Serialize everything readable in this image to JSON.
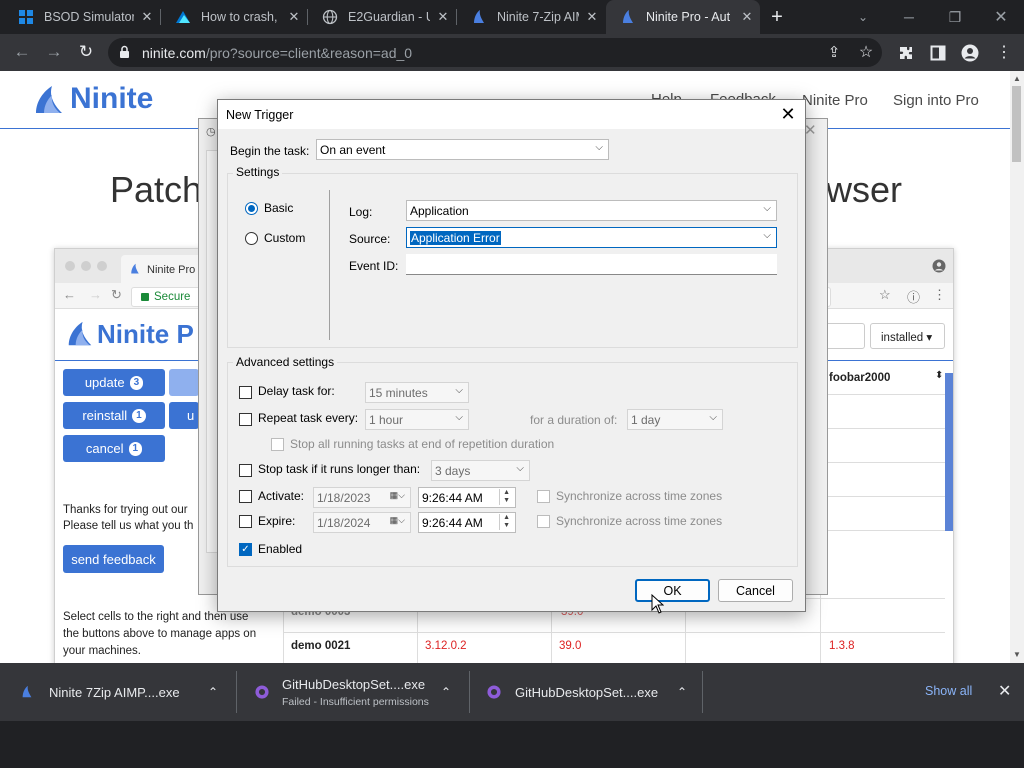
{
  "browser": {
    "tabs": [
      {
        "title": "BSOD Simulator",
        "fav": "windows-icon"
      },
      {
        "title": "How to crash, h",
        "fav": "azure-icon"
      },
      {
        "title": "E2Guardian - Ur",
        "fav": "globe-icon"
      },
      {
        "title": "Ninite 7-Zip AIM",
        "fav": "ninite-icon"
      },
      {
        "title": "Ninite Pro - Aut",
        "fav": "ninite-icon",
        "active": true
      }
    ],
    "url_host": "ninite.com",
    "url_path": "/pro?source=client&reason=ad_0"
  },
  "site": {
    "logo": "Ninite",
    "nav": [
      "Help",
      "Feedback",
      "Ninite Pro",
      "Sign into Pro"
    ],
    "hero_left": "Patch",
    "hero_right": "wser",
    "accent": "#3b73d3",
    "inner_window": {
      "tab_title": "Ninite Pro",
      "secure": "Secure",
      "logo": "Ninite P",
      "buttons": [
        {
          "label": "update",
          "count": "3"
        },
        {
          "label": "reinstall",
          "count": "1"
        },
        {
          "label": "cancel",
          "count": "1"
        }
      ],
      "thanks_line1": "Thanks for trying out our",
      "thanks_line2": "Please tell us what you th",
      "send_feedback": "send feedback",
      "select_text": [
        "Select cells to the right and then use",
        "the buttons above to manage apps on",
        "your machines."
      ],
      "filter_select": "installed",
      "col_header": "foobar2000",
      "rows": [
        {
          "machine": "demo 0003",
          "v1": "",
          "v2": "39.0",
          "v3": ""
        },
        {
          "machine": "demo 0021",
          "v1": "3.12.0.2",
          "v2": "39.0",
          "v3": "1.3.8"
        }
      ]
    }
  },
  "dialog": {
    "title": "New Trigger",
    "begin_label": "Begin the task:",
    "begin_value": "On an event",
    "settings_label": "Settings",
    "radio_basic": "Basic",
    "radio_custom": "Custom",
    "log_label": "Log:",
    "log_value": "Application",
    "source_label": "Source:",
    "source_value": "Application Error",
    "eventid_label": "Event ID:",
    "eventid_value": "",
    "advanced_label": "Advanced settings",
    "delay_label": "Delay task for:",
    "delay_value": "15 minutes",
    "repeat_label": "Repeat task every:",
    "repeat_value": "1 hour",
    "duration_label": "for a duration of:",
    "duration_value": "1 day",
    "stop_all_label": "Stop all running tasks at end of repetition duration",
    "stop_longer_label": "Stop task if it runs longer than:",
    "stop_longer_value": "3 days",
    "activate_label": "Activate:",
    "activate_date": "1/18/2023",
    "activate_time": "9:26:44 AM",
    "expire_label": "Expire:",
    "expire_date": "1/18/2024",
    "expire_time": "9:26:44 AM",
    "sync_label": "Synchronize across time zones",
    "enabled_label": "Enabled",
    "ok": "OK",
    "cancel": "Cancel"
  },
  "downloads": {
    "items": [
      {
        "name": "Ninite 7Zip AIMP....exe",
        "status": ""
      },
      {
        "name": "GitHubDesktopSet....exe",
        "status": "Failed - Insufficient permissions"
      },
      {
        "name": "GitHubDesktopSet....exe",
        "status": ""
      }
    ],
    "show_all": "Show all"
  }
}
